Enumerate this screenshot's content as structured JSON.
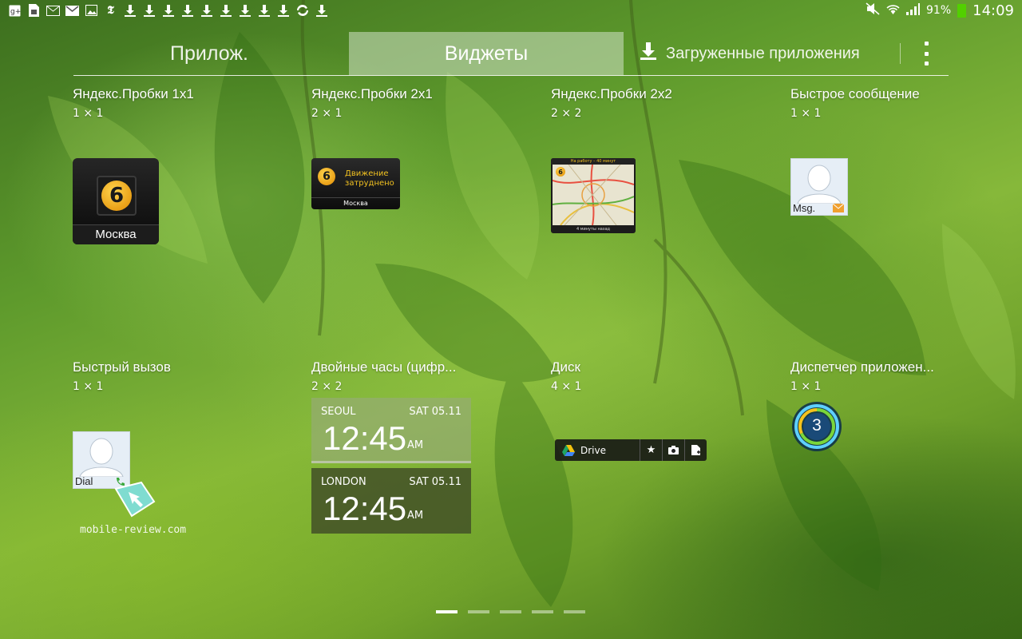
{
  "status_bar": {
    "left_icons": [
      "google-plus-icon",
      "sim-icon",
      "email-icon",
      "gmail-icon",
      "gallery-icon",
      "nytimes-icon",
      "download-icon",
      "download-icon",
      "download-icon",
      "download-icon",
      "download-icon",
      "download-icon",
      "download-icon",
      "download-icon",
      "download-icon",
      "sync-icon",
      "download-icon"
    ],
    "battery": "91%",
    "time": "14:09"
  },
  "tabs": {
    "apps": "Прилож.",
    "widgets": "Виджеты",
    "downloads": "Загруженные приложения"
  },
  "widgets": [
    {
      "title": "Яндекс.Пробки 1x1",
      "size": "1 × 1",
      "score": "6",
      "city": "Москва"
    },
    {
      "title": "Яндекс.Пробки 2x1",
      "size": "2 × 1",
      "score": "6",
      "status": "Движение затруднено",
      "city": "Москва"
    },
    {
      "title": "Яндекс.Пробки 2x2",
      "size": "2 × 2",
      "score": "6",
      "header": "На работу – 40 минут",
      "footer": "4 минуты назад"
    },
    {
      "title": "Быстрое сообщение",
      "size": "1 × 1",
      "label": "Msg."
    },
    {
      "title": "Быстрый вызов",
      "size": "1 × 1",
      "label": "Dial"
    },
    {
      "title": "Двойные часы (цифр...",
      "size": "2 × 2",
      "clocks": [
        {
          "city": "SEOUL",
          "date": "SAT 05.11",
          "time": "12:45",
          "ampm": "AM"
        },
        {
          "city": "LONDON",
          "date": "SAT 05.11",
          "time": "12:45",
          "ampm": "AM"
        }
      ]
    },
    {
      "title": "Диск",
      "size": "4 × 1",
      "label": "Drive"
    },
    {
      "title": "Диспетчер приложен...",
      "size": "1 × 1",
      "count": "3"
    }
  ],
  "watermark": "mobile-review.com",
  "pager": {
    "pages": 5,
    "active": 1
  }
}
